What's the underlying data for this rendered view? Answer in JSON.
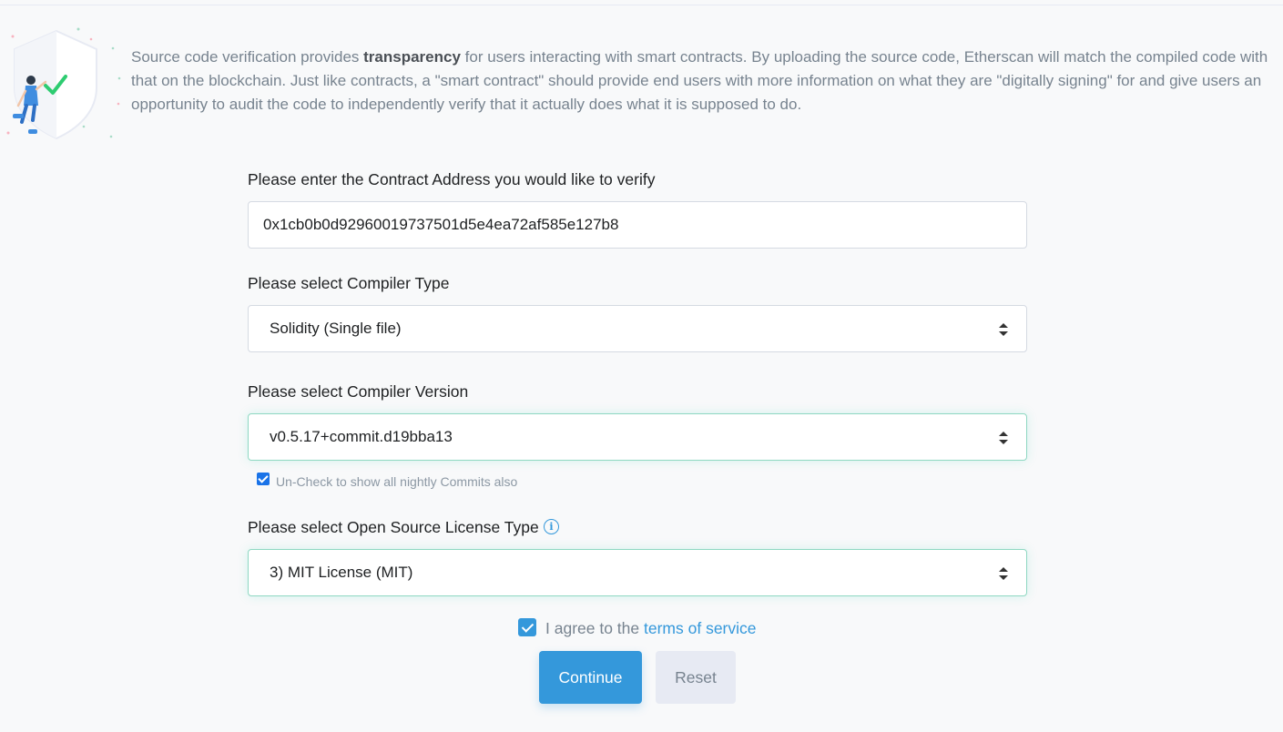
{
  "intro": {
    "text_before": "Source code verification provides ",
    "text_bold": "transparency",
    "text_after": " for users interacting with smart contracts. By uploading the source code, Etherscan will match the compiled code with that on the blockchain. Just like contracts, a \"smart contract\" should provide end users with more information on what they are \"digitally signing\" for and give users an opportunity to audit the code to independently verify that it actually does what it is supposed to do."
  },
  "form": {
    "address_label": "Please enter the Contract Address you would like to verify",
    "address_value": "0x1cb0b0d92960019737501d5e4ea72af585e127b8",
    "compiler_type_label": "Please select Compiler Type",
    "compiler_type_value": "Solidity (Single file)",
    "compiler_version_label": "Please select Compiler Version",
    "compiler_version_value": "v0.5.17+commit.d19bba13",
    "nightly_label": "Un-Check to show all nightly Commits also",
    "nightly_checked": true,
    "license_label": "Please select Open Source License Type",
    "license_value": "3) MIT License (MIT)",
    "agree_text": "I agree to the ",
    "agree_link": "terms of service",
    "agree_checked": true,
    "continue_label": "Continue",
    "reset_label": "Reset"
  },
  "icons": {
    "license_info": "info-circle-icon",
    "illustration": "shield-check-illustration"
  },
  "colors": {
    "primary": "#3498db",
    "focus_border": "#8fd8c2",
    "muted_text": "#77838f",
    "check_green": "#2ecc71"
  }
}
